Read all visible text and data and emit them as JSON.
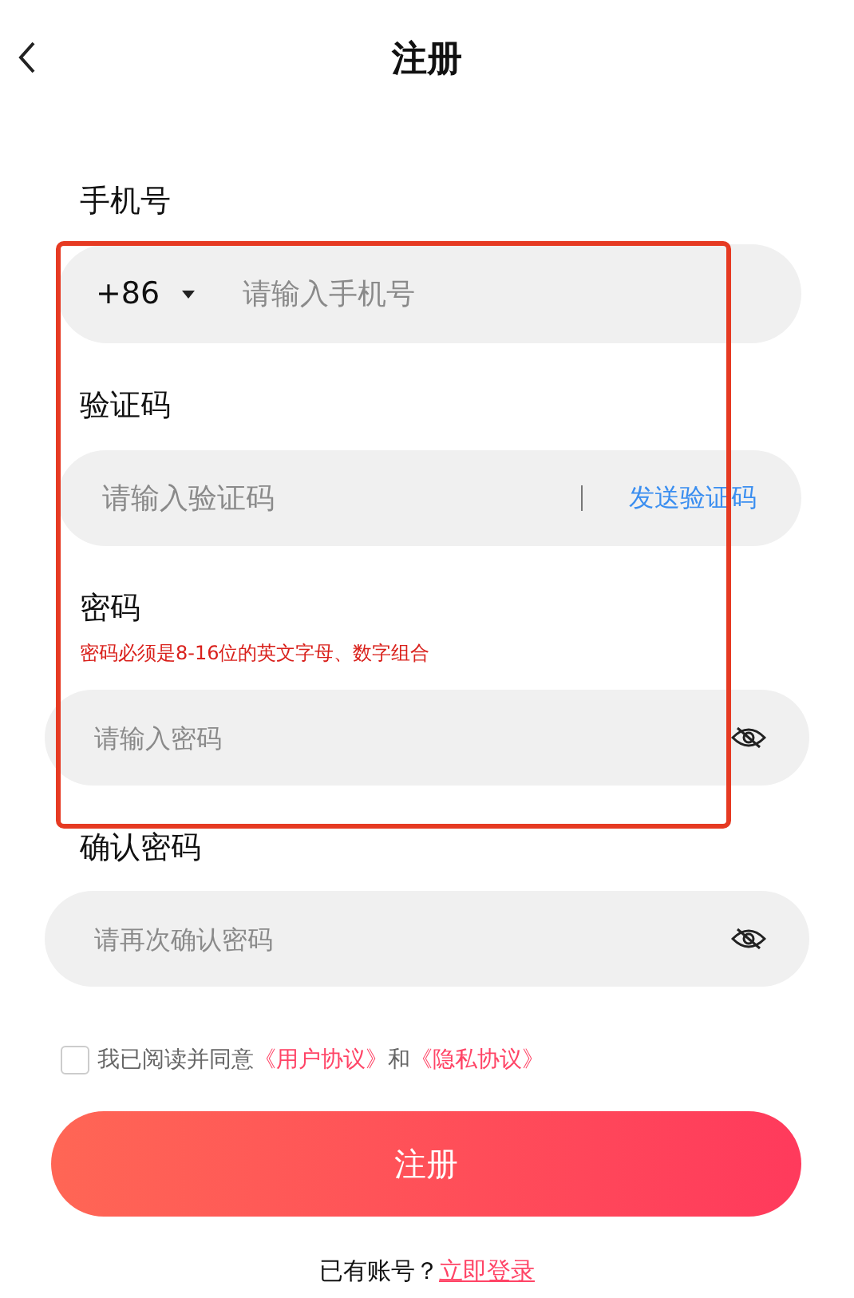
{
  "header": {
    "title": "注册"
  },
  "fields": [
    {
      "kind": "phone",
      "label": "手机号",
      "country_code": "+86",
      "placeholder": "请输入手机号"
    },
    {
      "kind": "code",
      "label": "验证码",
      "placeholder": "请输入验证码",
      "action": "发送验证码"
    },
    {
      "kind": "password",
      "label": "密码",
      "hint": "密码必须是8-16位的英文字母、数字组合",
      "placeholder": "请输入密码"
    },
    {
      "kind": "password",
      "label": "确认密码",
      "placeholder": "请再次确认密码"
    }
  ],
  "agreement": {
    "checked": false,
    "text": "我已阅读并同意",
    "links": [
      "《用户协议》",
      "《隐私协议》"
    ],
    "joiner": "和"
  },
  "submit": "注册",
  "footer": {
    "text": "已有账号？",
    "link": "立即登录"
  }
}
